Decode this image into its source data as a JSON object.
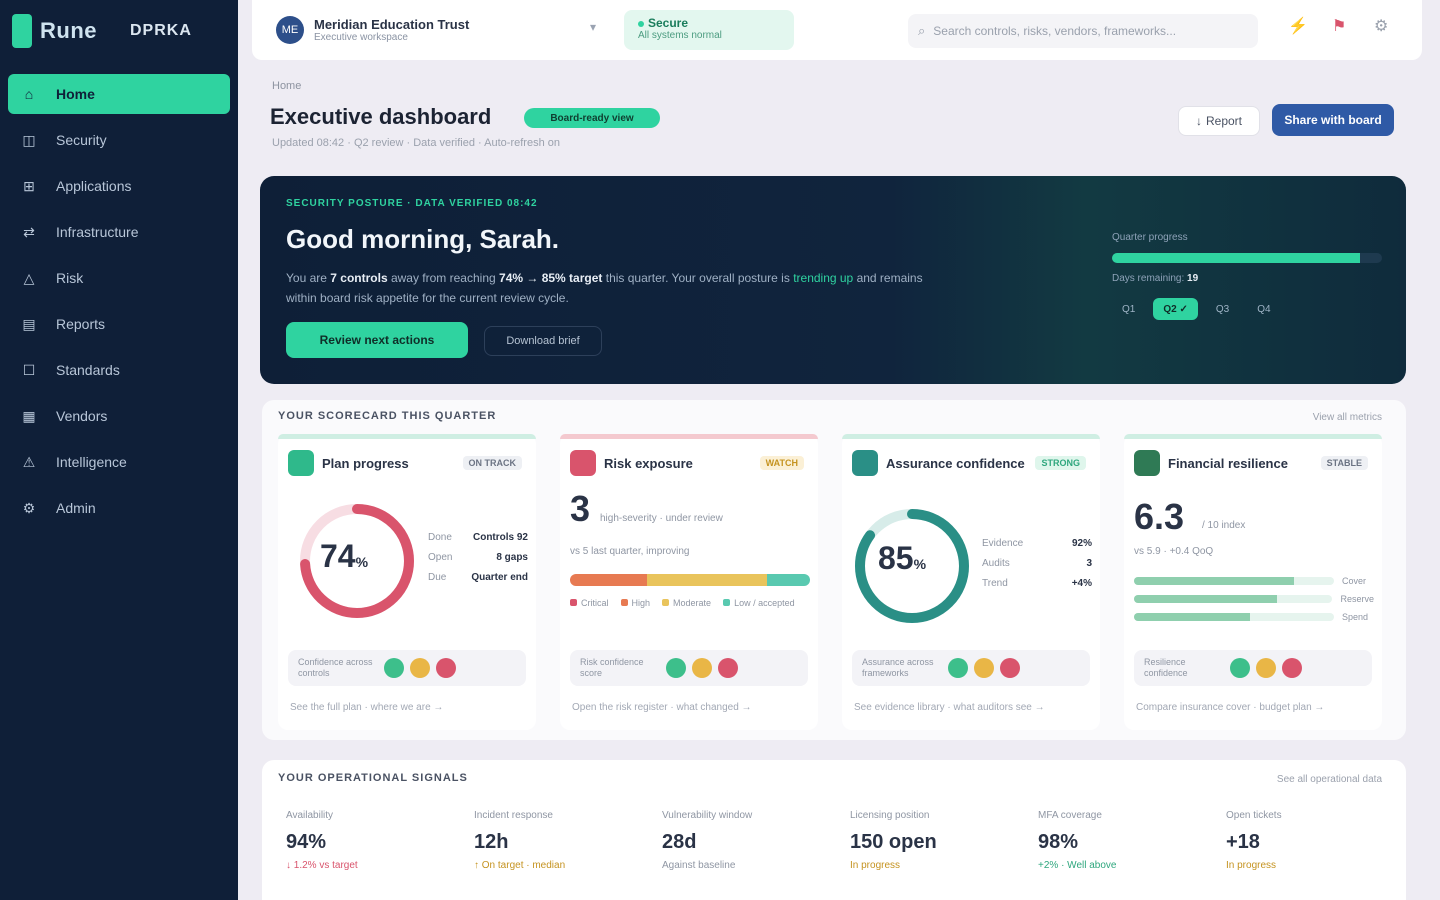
{
  "brand": {
    "logo_text": "Rune",
    "org_tag": "DPRKA"
  },
  "sidebar": {
    "items": [
      {
        "label": "Home",
        "icon": "home-icon",
        "glyph": "⌂"
      },
      {
        "label": "Security",
        "icon": "shield-icon",
        "glyph": "◫"
      },
      {
        "label": "Applications",
        "icon": "apps-icon",
        "glyph": "⊞"
      },
      {
        "label": "Infrastructure",
        "icon": "server-icon",
        "glyph": "⇄"
      },
      {
        "label": "Risk",
        "icon": "alert-icon",
        "glyph": "△"
      },
      {
        "label": "Reports",
        "icon": "report-icon",
        "glyph": "▤"
      },
      {
        "label": "Standards",
        "icon": "standards-icon",
        "glyph": "☐"
      },
      {
        "label": "Vendors",
        "icon": "vendors-icon",
        "glyph": "▦"
      },
      {
        "label": "Intelligence",
        "icon": "intel-icon",
        "glyph": "⚠"
      },
      {
        "label": "Admin",
        "icon": "gear-icon",
        "glyph": "⚙"
      }
    ]
  },
  "topbar": {
    "org_initials": "ME",
    "org_name": "Meridian Education Trust",
    "org_sub": "Executive workspace",
    "status_title": "Secure",
    "status_sub": "All systems normal",
    "search_placeholder": "Search controls, risks, vendors, frameworks..."
  },
  "header": {
    "breadcrumb": "Home",
    "title": "Executive dashboard",
    "badge": "Board-ready view",
    "subtitle": "Updated 08:42 · Q2 review · Data verified · Auto-refresh on",
    "report_btn": "Report",
    "primary_btn": "Share with board"
  },
  "hero": {
    "eyebrow": "SECURITY POSTURE · DATA VERIFIED 08:42",
    "title": "Good morning, Sarah.",
    "text_a": "You are ",
    "text_b": "7 controls",
    "text_c": " away from reaching ",
    "text_d": "74% → 85% target",
    "text_e": " this quarter. Your overall posture is ",
    "text_f": "trending up",
    "text_g": " and remains within board risk appetite for the current review cycle.",
    "btn1": "Review next actions",
    "btn2": "Download brief",
    "panel_label": "Quarter progress",
    "panel_progress": 0.92,
    "panel_meta_a": "Days remaining: ",
    "panel_meta_b": "19",
    "chips": [
      "Q1",
      "Q2 ✓",
      "Q3",
      "Q4"
    ]
  },
  "scorecards": {
    "title": "YOUR SCORECARD THIS QUARTER",
    "link": "View all metrics",
    "cards": [
      {
        "name": "Plan progress",
        "tag": "ON TRACK",
        "ring_value": "74",
        "ring_pct": 0.74,
        "kv": [
          [
            "Done",
            "Controls 92"
          ],
          [
            "Open",
            "8 gaps"
          ],
          [
            "Due",
            "Quarter end"
          ]
        ],
        "foot": "Confidence across controls",
        "link": "See the full plan · where we are →"
      },
      {
        "name": "Risk exposure",
        "tag": "WATCH",
        "big": "3",
        "big_note": "high-severity · under review",
        "sub": "vs 5 last quarter, improving",
        "bar": [
          0.32,
          0.5,
          0.18
        ],
        "legend": [
          "Critical",
          "High",
          "Moderate",
          "Low / accepted"
        ],
        "foot": "Risk confidence score",
        "link": "Open the risk register · what changed →"
      },
      {
        "name": "Assurance confidence",
        "tag": "STRONG",
        "ring_value": "85",
        "ring_pct": 0.85,
        "kv": [
          [
            "Evidence",
            "92%"
          ],
          [
            "Audits",
            "3"
          ],
          [
            "Trend",
            "+4%"
          ]
        ],
        "foot": "Assurance across frameworks",
        "link": "See evidence library · what auditors see →"
      },
      {
        "name": "Financial resilience",
        "tag": "STABLE",
        "big": "6.3",
        "big_note": "/ 10 index",
        "sub": "vs 5.9 · +0.4 QoQ",
        "bars": [
          0.8,
          0.72,
          0.58
        ],
        "bar_labels": [
          "Cover",
          "Reserve",
          "Spend"
        ],
        "foot": "Resilience confidence",
        "link": "Compare insurance cover · budget plan →"
      }
    ]
  },
  "ops": {
    "title": "YOUR OPERATIONAL SIGNALS",
    "link": "See all operational data",
    "metrics": [
      {
        "label": "Availability",
        "value": "94%",
        "sub": "↓ 1.2% vs target"
      },
      {
        "label": "Incident response",
        "value": "12h",
        "sub": "↑ On target · median"
      },
      {
        "label": "Vulnerability window",
        "value": "28d",
        "sub": "Against baseline"
      },
      {
        "label": "Licensing position",
        "value": "150 open",
        "sub": "In progress"
      },
      {
        "label": "MFA coverage",
        "value": "98%",
        "sub": "+2% · Well above"
      },
      {
        "label": "Open tickets",
        "value": "+18",
        "sub": "In progress"
      }
    ]
  },
  "colors": {
    "accent": "#2fd3a0",
    "navy": "#0f1f38",
    "danger": "#d9546c",
    "warn": "#e9b646",
    "teal": "#2a8f86",
    "blue": "#2f5aa6"
  }
}
